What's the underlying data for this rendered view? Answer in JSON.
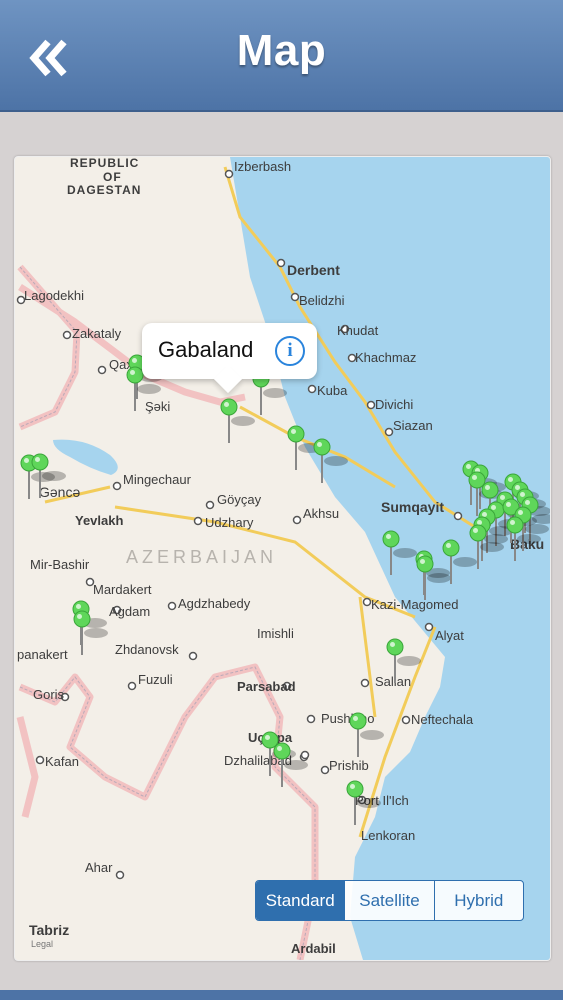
{
  "header": {
    "title": "Map",
    "back_icon": "double-chevron-left-icon"
  },
  "map": {
    "labels": {
      "dagestan1": "REPUBLIC",
      "dagestan2": "OF",
      "dagestan3": "DAGESTAN",
      "izberbash": "Izberbash",
      "derbent": "Derbent",
      "belidzhi": "Belidzhi",
      "lagodekhi": "Lagodekhi",
      "zakataly": "Zakataly",
      "khudat": "Khudat",
      "khachmaz": "Khachmaz",
      "qax": "Qax",
      "seki": "Şəki",
      "kuba": "Kuba",
      "divichi": "Divichi",
      "siazan": "Siazan",
      "mingechaur": "Mingechaur",
      "ganca": "Gəncə",
      "goycay": "Göyçay",
      "sumqayit": "Sumqayit",
      "yevlakh": "Yevlakh",
      "udzhary": "Udzhary",
      "akhsu": "Akhsu",
      "baku": "Baku",
      "azerbaijan": "AZERBAIJAN",
      "mirbashir": "Mir-Bashir",
      "mardakert": "Mardakert",
      "agdam": "Agdam",
      "agdzhabedy": "Agdzhabedy",
      "kazimagomed": "Kazi-Magomed",
      "stepanakert": "panakert",
      "zhdanovsk": "Zhdanovsk",
      "imishli": "Imishli",
      "alyat": "Alyat",
      "fuzuli": "Fuzuli",
      "parsabad": "Parsabad",
      "salian": "Salian",
      "goris": "Goris",
      "pushkino": "Pushkino",
      "neftechala": "Neftechala",
      "ucarpa": "Uçarpa",
      "dzhalilabad": "Dzhalilabad",
      "kafan": "Kafan",
      "prishib": "Prishib",
      "portilich": "Port Il'Ich",
      "lenkoran": "Lenkoran",
      "ahar": "Ahar",
      "tabriz": "Tabriz",
      "ardabil": "Ardabil",
      "legal": "Legal"
    },
    "callout": {
      "title": "Gabaland",
      "info_icon": "info-circle-icon"
    },
    "pin_color": "#5fd65a",
    "water_color": "#a6d4ee",
    "land_color": "#f3efe8"
  },
  "map_type": {
    "standard": "Standard",
    "satellite": "Satellite",
    "hybrid": "Hybrid",
    "selected": "Standard"
  }
}
